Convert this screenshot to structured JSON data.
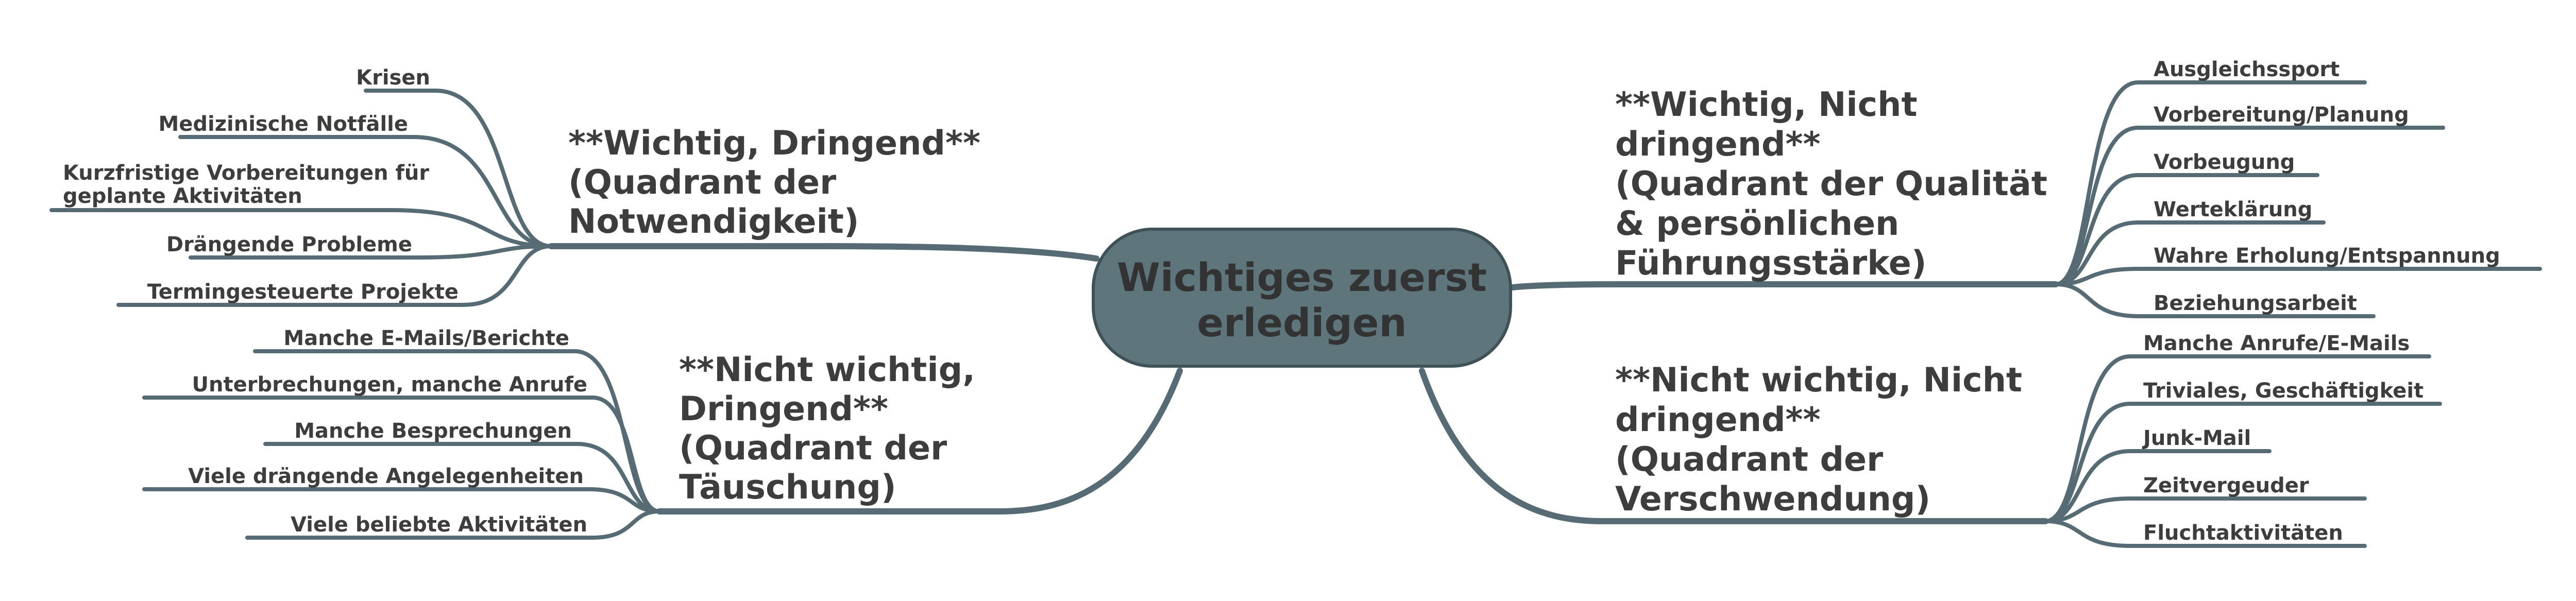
{
  "center": {
    "lines": [
      "Wichtiges zuerst",
      "erledigen"
    ],
    "fill_color": "#5e757c"
  },
  "line_color": "#566b74",
  "branches": [
    {
      "id": "top-left",
      "lines": [
        "**Wichtig, Dringend**",
        "(Quadrant der",
        "Notwendigkeit)"
      ],
      "leaves": [
        [
          "Krisen"
        ],
        [
          "Medizinische Notfälle"
        ],
        [
          "Kurzfristige Vorbereitungen für",
          "geplante Aktivitäten"
        ],
        [
          "Drängende Probleme"
        ],
        [
          "Termingesteuerte Projekte"
        ]
      ]
    },
    {
      "id": "bottom-left",
      "lines": [
        "**Nicht wichtig,",
        "Dringend**",
        "(Quadrant der",
        "Täuschung)"
      ],
      "leaves": [
        [
          "Manche E-Mails/Berichte"
        ],
        [
          "Unterbrechungen, manche Anrufe"
        ],
        [
          "Manche Besprechungen"
        ],
        [
          "Viele drängende Angelegenheiten"
        ],
        [
          "Viele beliebte Aktivitäten"
        ]
      ]
    },
    {
      "id": "top-right",
      "lines": [
        "**Wichtig, Nicht",
        "dringend**",
        "(Quadrant der Qualität",
        "& persönlichen",
        "Führungsstärke)"
      ],
      "leaves": [
        [
          "Ausgleichssport"
        ],
        [
          "Vorbereitung/Planung"
        ],
        [
          "Vorbeugung"
        ],
        [
          "Werteklärung"
        ],
        [
          "Wahre Erholung/Entspannung"
        ],
        [
          "Beziehungsarbeit"
        ]
      ]
    },
    {
      "id": "bottom-right",
      "lines": [
        "**Nicht wichtig, Nicht",
        "dringend**",
        "(Quadrant der",
        "Verschwendung)"
      ],
      "leaves": [
        [
          "Manche Anrufe/E-Mails"
        ],
        [
          "Triviales, Geschäftigkeit"
        ],
        [
          "Junk-Mail"
        ],
        [
          "Zeitvergeuder"
        ],
        [
          "Fluchtaktivitäten"
        ]
      ]
    }
  ]
}
